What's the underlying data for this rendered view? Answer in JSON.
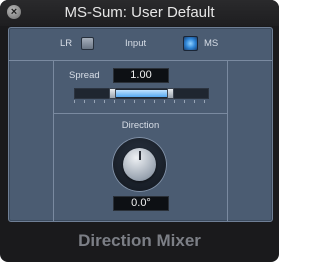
{
  "window": {
    "title": "MS-Sum: User Default",
    "close_glyph": "×",
    "footer_title": "Direction Mixer"
  },
  "input": {
    "lr_label": "LR",
    "label": "Input",
    "ms_label": "MS",
    "lr_checked": false,
    "ms_active": true
  },
  "spread": {
    "label": "Spread",
    "value_text": "1.00",
    "range": [
      0,
      2
    ],
    "value": 1.0
  },
  "direction": {
    "label": "Direction",
    "value_text": "0.0°",
    "value": 0
  },
  "colors": {
    "panel": "#4b5c72",
    "accent": "#57a9f0"
  }
}
